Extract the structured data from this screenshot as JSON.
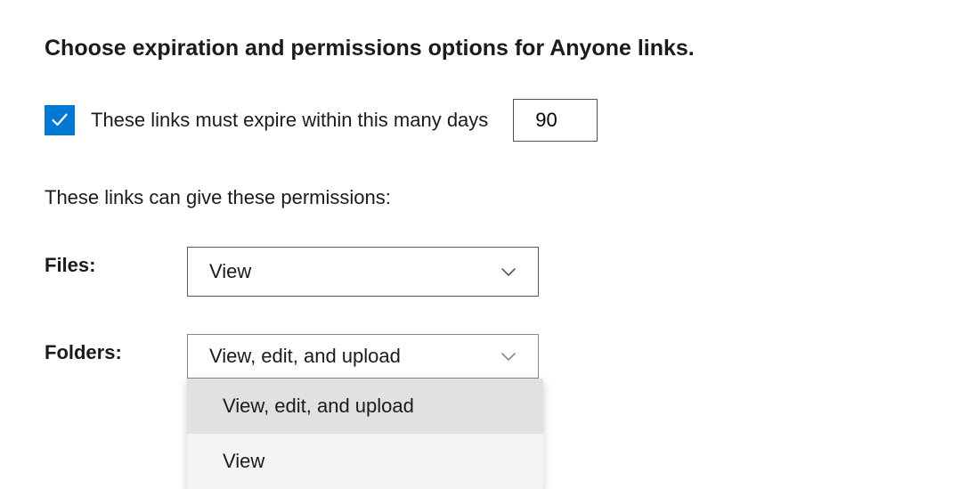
{
  "section": {
    "title": "Choose expiration and permissions options for Anyone links."
  },
  "expiration": {
    "checkbox_checked": true,
    "label": "These links must expire within this many days",
    "days_value": "90"
  },
  "permissions": {
    "intro": "These links can give these permissions:",
    "files": {
      "label": "Files:",
      "selected": "View"
    },
    "folders": {
      "label": "Folders:",
      "selected": "View, edit, and upload",
      "options": [
        "View, edit, and upload",
        "View"
      ]
    }
  }
}
